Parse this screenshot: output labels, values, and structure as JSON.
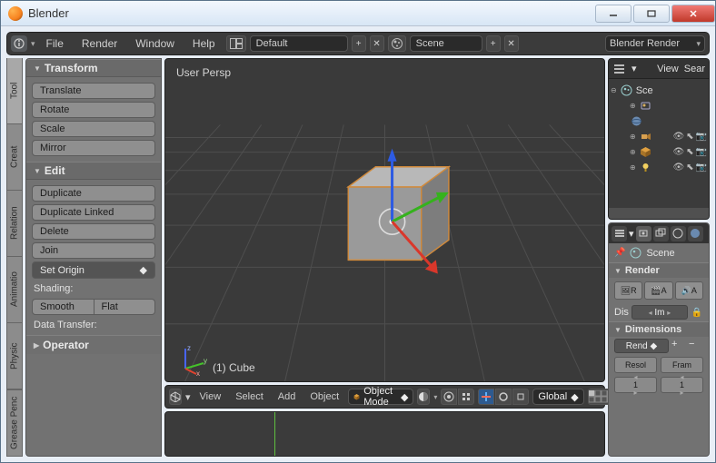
{
  "window": {
    "title": "Blender"
  },
  "menubar": {
    "items": [
      "File",
      "Render",
      "Window",
      "Help"
    ],
    "layout_name": "Default",
    "scene_name": "Scene",
    "engine": "Blender Render"
  },
  "side_tabs": [
    "Tool",
    "Creat",
    "Relation",
    "Animatio",
    "Physic",
    "Grease Penc"
  ],
  "tool_panel": {
    "transform": {
      "title": "Transform",
      "translate": "Translate",
      "rotate": "Rotate",
      "scale": "Scale",
      "mirror": "Mirror"
    },
    "edit": {
      "title": "Edit",
      "duplicate": "Duplicate",
      "duplicate_linked": "Duplicate Linked",
      "delete": "Delete",
      "join": "Join",
      "set_origin": "Set Origin",
      "shading_label": "Shading:",
      "smooth": "Smooth",
      "flat": "Flat",
      "data_transfer": "Data Transfer:"
    },
    "operator": {
      "title": "Operator"
    }
  },
  "viewport": {
    "perspective_label": "User Persp",
    "object_label": "(1) Cube"
  },
  "viewport_toolbar": {
    "items": [
      "View",
      "Select",
      "Add",
      "Object"
    ],
    "mode": "Object Mode",
    "orientation": "Global"
  },
  "outliner": {
    "view_label": "View",
    "search_label": "Sear",
    "scene_label": "Sce"
  },
  "properties": {
    "breadcrumb": "Scene",
    "render_title": "Render",
    "display_label": "Dis",
    "display_value": "Im",
    "dimensions_title": "Dimensions",
    "render_preset": "Rend",
    "resol_label": "Resol",
    "frame_label": "Fram",
    "resol_value": "1",
    "frame_value": "1"
  }
}
